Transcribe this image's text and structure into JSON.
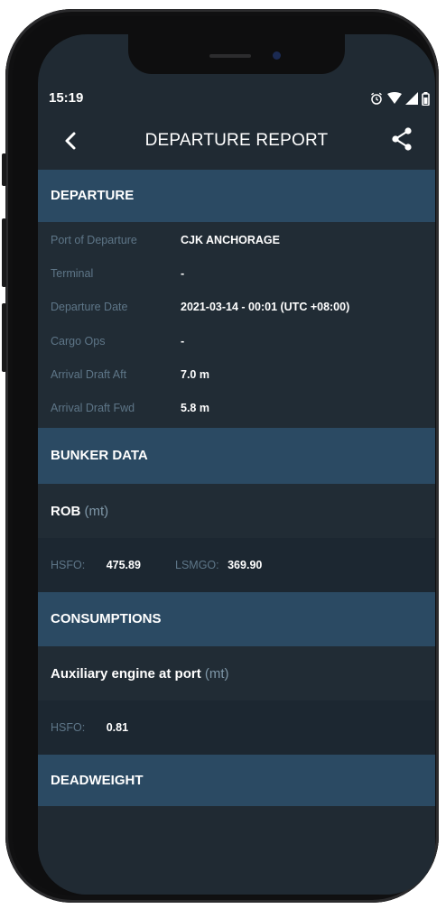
{
  "status_bar": {
    "time": "15:19"
  },
  "header": {
    "title": "DEPARTURE REPORT"
  },
  "departure": {
    "heading": "DEPARTURE",
    "fields": [
      {
        "label": "Port of Departure",
        "value": "CJK ANCHORAGE"
      },
      {
        "label": "Terminal",
        "value": "-"
      },
      {
        "label": "Departure Date",
        "value": "2021-03-14 - 00:01 (UTC +08:00)"
      },
      {
        "label": "Cargo Ops",
        "value": "-"
      },
      {
        "label": "Arrival Draft Aft",
        "value": "7.0 m"
      },
      {
        "label": "Arrival Draft Fwd",
        "value": "5.8 m"
      }
    ]
  },
  "bunker": {
    "heading": "BUNKER DATA",
    "rob_title": "ROB",
    "rob_unit": "(mt)",
    "hsfo_label": "HSFO:",
    "hsfo_value": "475.89",
    "lsmgo_label": "LSMGO:",
    "lsmgo_value": "369.90"
  },
  "consumptions": {
    "heading": "CONSUMPTIONS",
    "aux_title": "Auxiliary engine at port",
    "aux_unit": "(mt)",
    "hsfo_label": "HSFO:",
    "hsfo_value": "0.81"
  },
  "deadweight": {
    "heading": "DEADWEIGHT"
  },
  "colors": {
    "section": "#2b4a63",
    "background": "#202a33",
    "label": "#5e7688"
  }
}
